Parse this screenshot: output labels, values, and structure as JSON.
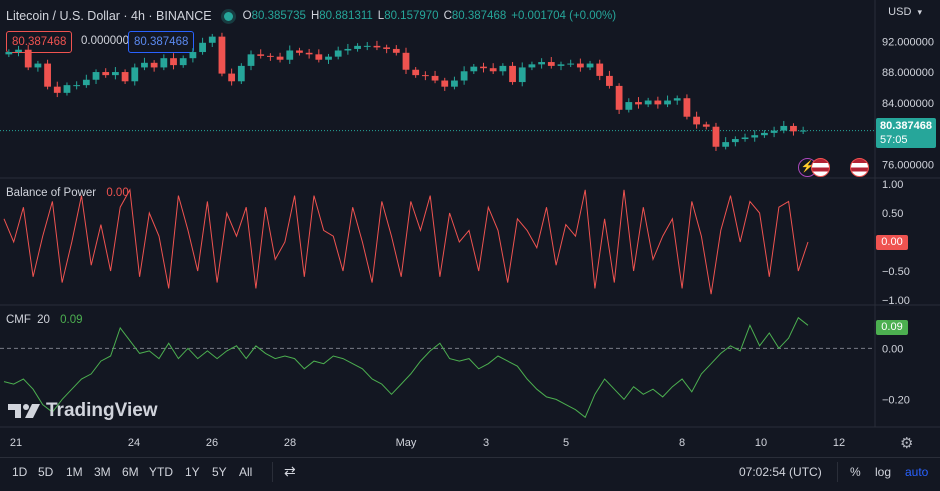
{
  "header": {
    "title": "Litecoin / U.S. Dollar · 4h · BINANCE",
    "open_label": "O",
    "open": "80.385735",
    "high_label": "H",
    "high": "80.881311",
    "low_label": "L",
    "low": "80.157970",
    "close_label": "C",
    "close": "80.387468",
    "change": "+0.001704 (+0.00%)"
  },
  "order_boxes": {
    "sell": "80.387468",
    "spread": "0.000000",
    "buy": "80.387468"
  },
  "currency_menu": "USD",
  "brand": "TradingView",
  "price_pane": {
    "last_price": "80.387468",
    "countdown": "57:05",
    "ticks": [
      "92.000000",
      "88.000000",
      "84.000000",
      "80.000000",
      "76.000000"
    ]
  },
  "bop_pane": {
    "title": "Balance of Power",
    "value": "0.00",
    "badge": "0.00",
    "ticks": [
      "1.00",
      "0.50",
      "0.00",
      "−0.50",
      "−1.00"
    ]
  },
  "cmf_pane": {
    "title": "CMF",
    "length": "20",
    "value": "0.09",
    "badge": "0.09",
    "ticks": [
      "0.00",
      "−0.20"
    ]
  },
  "time_axis": [
    "21",
    "24",
    "26",
    "28",
    "May",
    "3",
    "5",
    "8",
    "10",
    "12"
  ],
  "bottom_toolbar": {
    "timeframes": [
      "1D",
      "5D",
      "1M",
      "3M",
      "6M",
      "YTD",
      "1Y",
      "5Y",
      "All"
    ],
    "clock": "07:02:54 (UTC)",
    "percent": "%",
    "log": "log",
    "auto": "auto"
  },
  "colors": {
    "background": "#131722",
    "up": "#26a69a",
    "down": "#ef5350",
    "bop_line": "#ef5350",
    "cmf_line": "#4caf50",
    "auto": "#2962ff"
  },
  "chart_data": [
    {
      "type": "candlestick",
      "title": "Litecoin / U.S. Dollar · 4h · BINANCE",
      "ylim": [
        74.5,
        94.5
      ],
      "x_ticks": [
        "21",
        "24",
        "26",
        "28",
        "May",
        "3",
        "5",
        "8",
        "10",
        "12"
      ],
      "close_path": [
        90.6,
        90.9,
        88.6,
        89.1,
        86.1,
        85.3,
        86.3,
        86.3,
        87.0,
        88.0,
        87.6,
        88.0,
        86.8,
        88.6,
        89.2,
        88.6,
        89.8,
        88.9,
        89.8,
        90.6,
        91.8,
        92.6,
        87.8,
        86.8,
        88.8,
        90.3,
        90.1,
        90.0,
        89.6,
        90.8,
        90.5,
        90.3,
        89.6,
        90.0,
        90.8,
        91.0,
        91.4,
        91.4,
        91.2,
        91.0,
        90.5,
        88.3,
        87.6,
        87.5,
        86.9,
        86.1,
        86.9,
        88.1,
        88.7,
        88.5,
        88.1,
        88.8,
        86.7,
        88.6,
        89.0,
        89.3,
        88.8,
        89.0,
        89.1,
        88.6,
        89.1,
        87.5,
        86.2,
        83.1,
        84.1,
        83.8,
        84.3,
        83.8,
        84.3,
        84.6,
        82.2,
        81.2,
        80.9,
        78.3,
        78.9,
        79.3,
        79.5,
        79.8,
        80.1,
        80.4,
        81.0,
        80.3,
        80.4
      ]
    },
    {
      "type": "line",
      "title": "Balance of Power",
      "ylim": [
        -1.0,
        1.0
      ],
      "y_ticks": [
        1.0,
        0.5,
        0.0,
        -0.5,
        -1.0
      ],
      "values": [
        0.4,
        0.0,
        0.6,
        -0.6,
        0.1,
        0.7,
        -0.7,
        0.0,
        0.8,
        -0.4,
        0.3,
        -0.5,
        0.6,
        0.9,
        -0.6,
        0.5,
        0.1,
        -0.8,
        0.8,
        0.2,
        -0.5,
        0.7,
        -0.7,
        0.5,
        0.1,
        0.6,
        -0.8,
        0.6,
        -0.3,
        0.0,
        0.8,
        -0.6,
        0.8,
        0.2,
        0.1,
        -0.5,
        0.6,
        0.0,
        -0.7,
        0.7,
        0.1,
        -0.6,
        0.7,
        0.2,
        0.8,
        -0.6,
        0.5,
        0.0,
        0.2,
        -0.5,
        0.6,
        0.2,
        -0.7,
        0.4,
        0.2,
        -0.1,
        0.6,
        -0.4,
        0.3,
        0.1,
        0.9,
        -0.8,
        0.4,
        -0.7,
        0.9,
        -0.5,
        0.6,
        -0.3,
        0.1,
        0.4,
        -0.8,
        0.7,
        0.1,
        -0.9,
        0.2,
        0.8,
        0.0,
        0.7,
        0.5,
        -0.6,
        0.6,
        0.7,
        -0.5,
        0.0
      ]
    },
    {
      "type": "line",
      "title": "CMF 20",
      "ylim": [
        -0.3,
        0.15
      ],
      "y_ticks": [
        0.0,
        -0.2
      ],
      "values": [
        -0.13,
        -0.14,
        -0.12,
        -0.16,
        -0.22,
        -0.25,
        -0.2,
        -0.16,
        -0.12,
        -0.1,
        -0.05,
        -0.03,
        0.08,
        0.03,
        -0.02,
        -0.01,
        -0.04,
        0.02,
        -0.04,
        0.0,
        -0.04,
        -0.01,
        -0.04,
        -0.01,
        0.01,
        -0.04,
        0.01,
        -0.02,
        -0.04,
        -0.03,
        -0.04,
        -0.08,
        -0.05,
        -0.06,
        -0.03,
        -0.04,
        -0.06,
        -0.08,
        -0.12,
        -0.14,
        -0.18,
        -0.14,
        -0.1,
        -0.05,
        -0.01,
        0.02,
        -0.04,
        -0.05,
        -0.04,
        -0.08,
        -0.06,
        -0.03,
        -0.05,
        -0.07,
        -0.12,
        -0.16,
        -0.19,
        -0.2,
        -0.22,
        -0.24,
        -0.27,
        -0.18,
        -0.12,
        -0.16,
        -0.2,
        -0.15,
        -0.18,
        -0.16,
        -0.19,
        -0.15,
        -0.12,
        -0.17,
        -0.1,
        -0.06,
        -0.02,
        0.01,
        -0.01,
        0.09,
        0.01,
        0.06,
        0.0,
        0.04,
        0.12,
        0.09
      ]
    }
  ]
}
